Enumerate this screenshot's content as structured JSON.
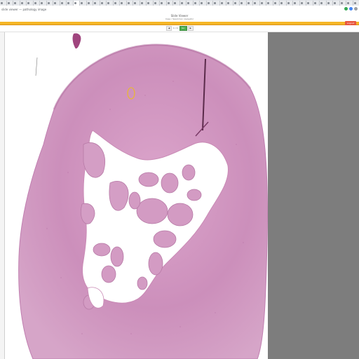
{
  "browser": {
    "tab_count": 54,
    "active_tab_index": 11,
    "url": "slide viewer — pathology image"
  },
  "app": {
    "title": "Slide Viewer",
    "subtitle": "Case / Specimen navigator",
    "logout_label": "Logout"
  },
  "nav": {
    "prev_label": "◀",
    "page_label": "1 / 1",
    "go_label": "Go",
    "next_label": "▶"
  },
  "colors": {
    "header_bar": "#f5b626",
    "tissue": "#c98ab5",
    "viewer_background": "#7d7d7d",
    "annotation": "#e7b53c"
  }
}
